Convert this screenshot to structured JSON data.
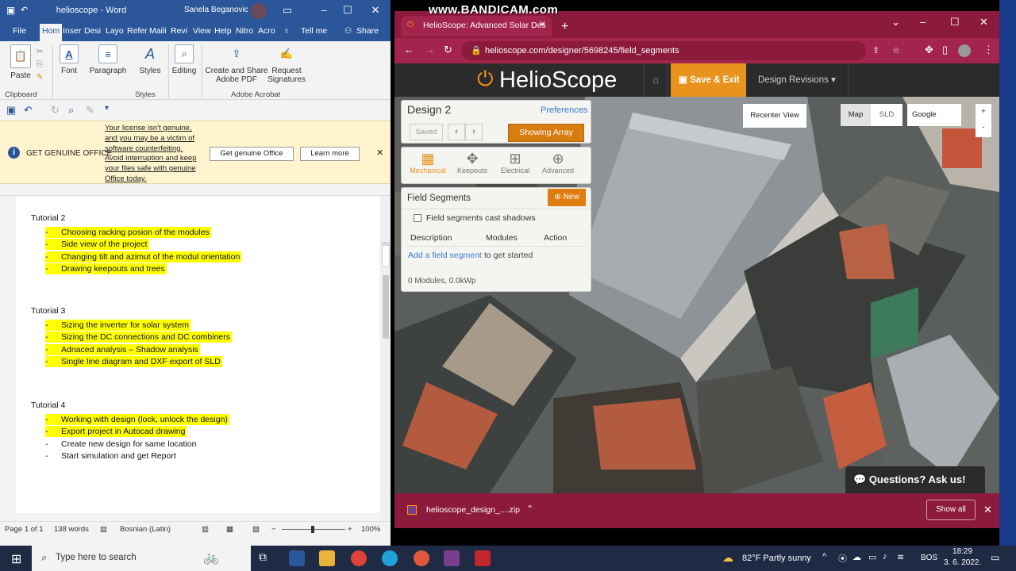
{
  "watermark": "www.BANDICAM.com",
  "word": {
    "title": "helioscope - Word",
    "user": "Sanela Beganovic",
    "tabs": [
      "File",
      "Hom",
      "Inser",
      "Desi",
      "Layo",
      "Refer",
      "Maili",
      "Revi",
      "View",
      "Help",
      "Nitro",
      "Acro"
    ],
    "tell_me": "Tell me",
    "share": "Share",
    "ribbon": {
      "paste": "Paste",
      "font": "Font",
      "paragraph": "Paragraph",
      "styles": "Styles",
      "editing": "Editing",
      "create_share": "Create and Share",
      "adobe_pdf": "Adobe PDF",
      "request": "Request",
      "signatures": "Signatures",
      "clipboard": "Clipboard",
      "styles_group": "Styles",
      "adobe_acrobat": "Adobe Acrobat"
    },
    "message": {
      "title": "GET GENUINE OFFICE",
      "text": "Your license isn't genuine, and you may be a victim of software counterfeiting. Avoid interruption and keep your files safe with genuine Office today.",
      "btn_genuine": "Get genuine Office",
      "btn_learn": "Learn more"
    },
    "side_hint": "Wa",
    "doc": [
      {
        "heading": "Tutorial 2",
        "items": [
          {
            "text": "Choosing racking posion of the modules",
            "hl": true
          },
          {
            "text": "Side view of the project",
            "hl": true
          },
          {
            "text": "Changing tilt and azimut of the modul orientation",
            "hl": true
          },
          {
            "text": "Drawing keepouts and trees",
            "hl": true
          }
        ]
      },
      {
        "heading": "Tutorial 3",
        "items": [
          {
            "text": "Sizing the inverter for solar system",
            "hl": true
          },
          {
            "text": "Sizing the DC connections and DC combiners",
            "hl": true
          },
          {
            "text": "Adnaced analysis – Shadow analysis",
            "hl": true
          },
          {
            "text": "Single line diagram and DXF export of SLD",
            "hl": true
          }
        ]
      },
      {
        "heading": "Tutorial 4",
        "items": [
          {
            "text": "Working with design (lock, unlock the design)",
            "hl": true
          },
          {
            "text": "Export project in Autocad drawing",
            "hl": true
          },
          {
            "text": "Create new design for same location",
            "hl": false
          },
          {
            "text": "Start simulation and get Report",
            "hl": false
          }
        ]
      }
    ],
    "status": {
      "page": "Page 1 of 1",
      "words": "138 words",
      "lang": "Bosnian (Latin)",
      "zoom": "100%"
    }
  },
  "chrome": {
    "tab_title": "HelioScope: Advanced Solar Des",
    "url": "helioscope.com/designer/5698245/field_segments",
    "download": {
      "file": "helioscope_design_....zip",
      "show_all": "Show all"
    }
  },
  "helioscope": {
    "logo": "HelioScope",
    "save_exit": "Save & Exit",
    "revisions": "Design Revisions",
    "design_name": "Design 2",
    "preferences": "Preferences",
    "saved": "Saved",
    "showing_array": "Showing Array",
    "tools": [
      "Mechanical",
      "Keepouts",
      "Electrical",
      "Advanced"
    ],
    "field_segments": "Field Segments",
    "new_btn": "New",
    "shadows": "Field segments cast shadows",
    "cols": [
      "Description",
      "Modules",
      "Action"
    ],
    "add_link": "Add a field segment",
    "add_rest": " to get started",
    "summary": "0 Modules, 0.0kWp",
    "recenter": "Recenter View",
    "map_types": [
      "Map",
      "SLD"
    ],
    "provider": "Google",
    "zoom_in": "+",
    "zoom_out": "-",
    "questions": "Questions? Ask us!"
  },
  "taskbar": {
    "search": "Type here to search",
    "weather": "82°F  Partly sunny",
    "lang": "BOS",
    "time": "18:29",
    "date": "3. 6. 2022."
  }
}
